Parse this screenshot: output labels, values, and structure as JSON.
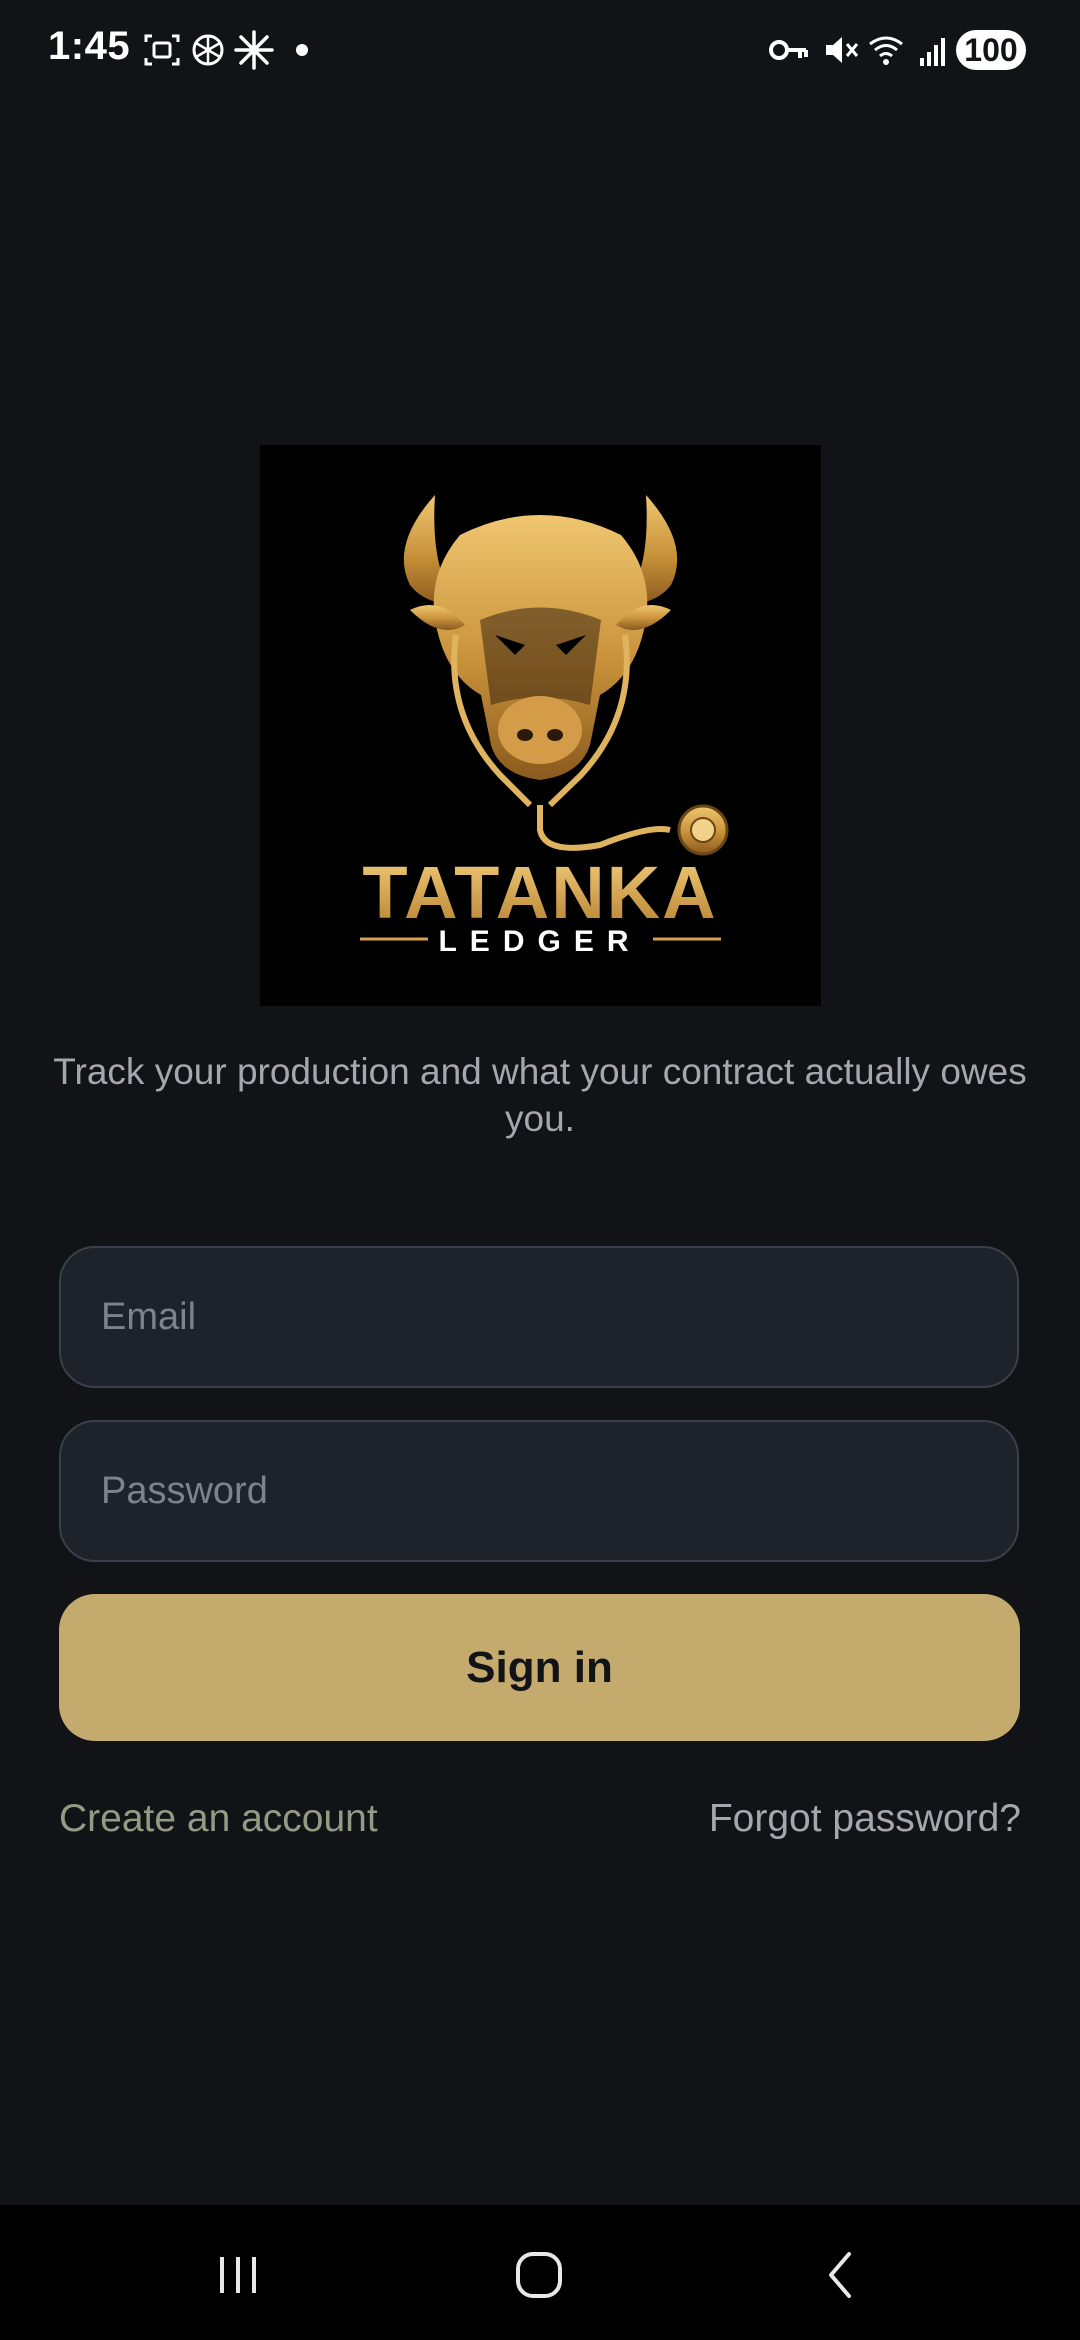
{
  "status_bar": {
    "time": "1:45",
    "battery": "100",
    "icons": [
      "screenshot-icon",
      "openai-icon",
      "sparkle-icon",
      "notification-dot-icon",
      "vpn-key-icon",
      "mute-icon",
      "wifi-icon",
      "signal-icon"
    ]
  },
  "logo": {
    "brand_name": "TATANKA",
    "brand_sub": "LEDGER",
    "brand_color": "#d4a24c"
  },
  "tagline": "Track your production and what your contract actually owes you.",
  "form": {
    "email_placeholder": "Email",
    "password_placeholder": "Password",
    "signin_label": "Sign in"
  },
  "links": {
    "create_account": "Create an account",
    "forgot_password": "Forgot password?"
  },
  "nav": {
    "icons": [
      "recents-icon",
      "home-icon",
      "back-icon"
    ]
  },
  "colors": {
    "background": "#121317",
    "accent": "#c4aa6d",
    "field_bg": "#1e232b"
  }
}
